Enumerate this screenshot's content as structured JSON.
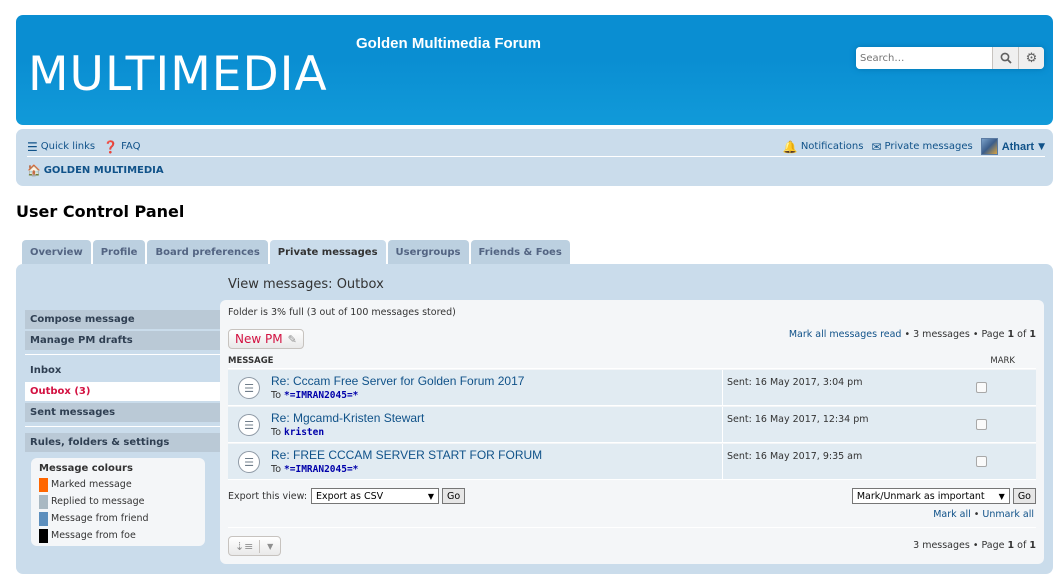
{
  "header": {
    "logo": "MULTIMEDIA",
    "site_title": "Golden Multimedia Forum",
    "search_placeholder": "Search…"
  },
  "navbar": {
    "quick_links": "Quick links",
    "faq": "FAQ",
    "notifications": "Notifications",
    "private_messages": "Private messages",
    "username": "Athart",
    "breadcrumb": "GOLDEN MULTIMEDIA"
  },
  "page_title": "User Control Panel",
  "tabs": [
    {
      "label": "Overview"
    },
    {
      "label": "Profile"
    },
    {
      "label": "Board preferences"
    },
    {
      "label": "Private messages"
    },
    {
      "label": "Usergroups"
    },
    {
      "label": "Friends & Foes"
    }
  ],
  "sidebar": {
    "compose": "Compose message",
    "drafts": "Manage PM drafts",
    "inbox": "Inbox",
    "outbox": "Outbox (3)",
    "sent": "Sent messages",
    "rules": "Rules, folders & settings",
    "colours_title": "Message colours",
    "legend": [
      {
        "label": "Marked message",
        "color": "#ff6600"
      },
      {
        "label": "Replied to message",
        "color": "#a9b8c2"
      },
      {
        "label": "Message from friend",
        "color": "#5d8fbd"
      },
      {
        "label": "Message from foe",
        "color": "#000000"
      }
    ]
  },
  "main": {
    "title": "View messages: Outbox",
    "folder_info": "Folder is 3% full (3 out of 100 messages stored)",
    "new_pm": "New PM",
    "mark_read": "Mark all messages read",
    "pagination_top": "• 3 messages • Page",
    "page_current": "1",
    "page_of": "of",
    "page_total": "1",
    "col_message": "MESSAGE",
    "col_mark": "MARK",
    "to_label": "To",
    "messages": [
      {
        "subject": "Re: Cccam Free Server for Golden Forum 2017",
        "to": "*=IMRAN2045=*",
        "sent": "Sent: 16 May 2017, 3:04 pm"
      },
      {
        "subject": "Re: Mgcamd-Kristen Stewart",
        "to": "kristen",
        "sent": "Sent: 16 May 2017, 12:34 pm"
      },
      {
        "subject": "Re: FREE CCCAM SERVER START FOR FORUM",
        "to": "*=IMRAN2045=*",
        "sent": "Sent: 16 May 2017, 9:35 am"
      }
    ],
    "export_label": "Export this view:",
    "export_option": "Export as CSV",
    "go": "Go",
    "mark_option": "Mark/Unmark as important",
    "mark_all": "Mark all",
    "bullet": "•",
    "unmark_all": "Unmark all",
    "pagination_bottom": "3 messages • Page"
  }
}
